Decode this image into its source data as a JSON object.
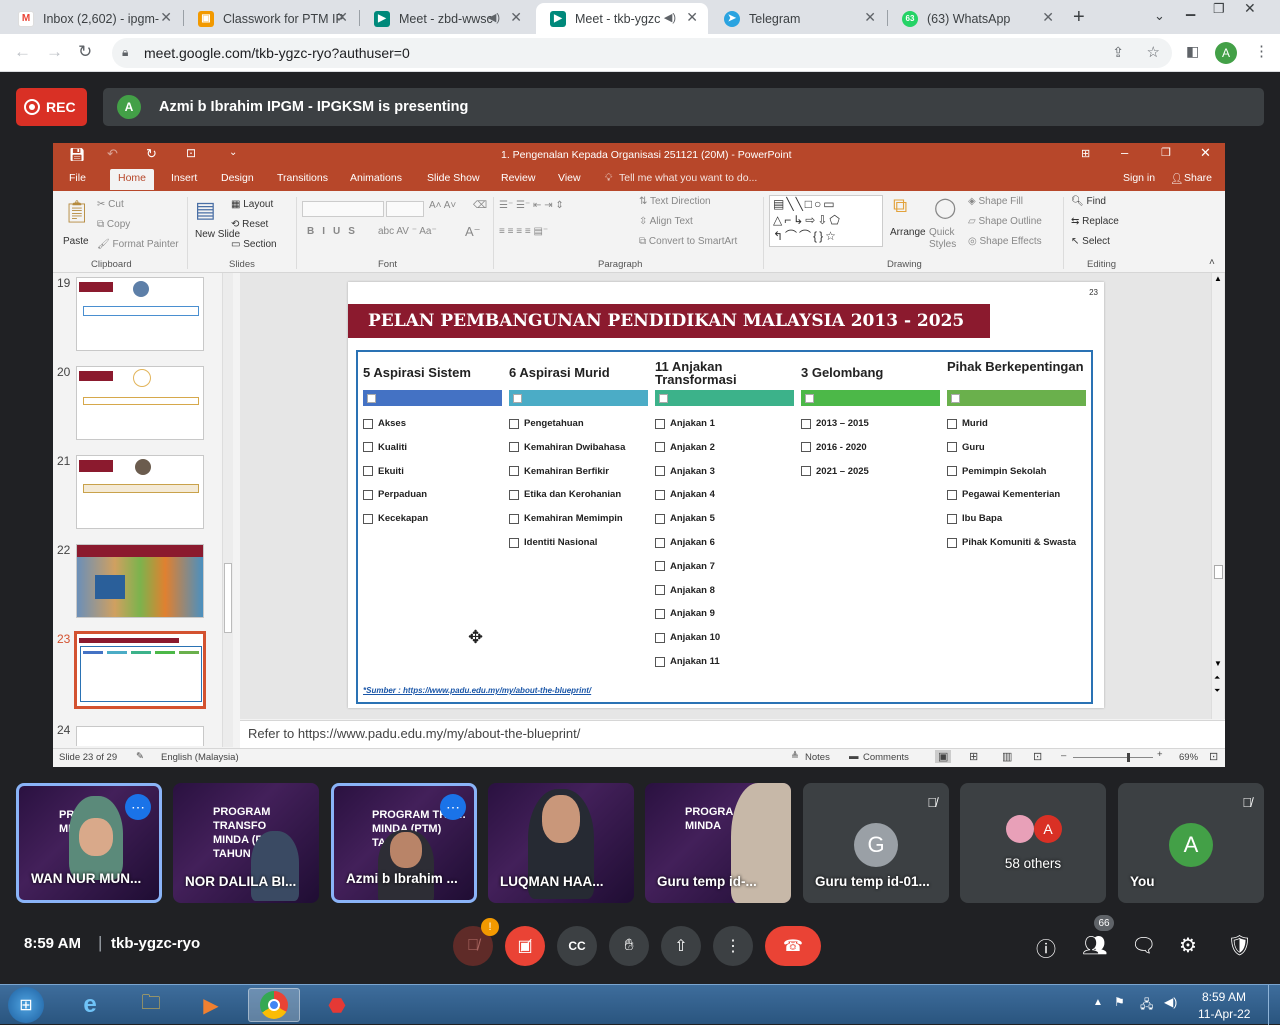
{
  "browser": {
    "tabs": [
      {
        "label": "Inbox (2,602) - ipgm-",
        "favicon": "gmail-icon"
      },
      {
        "label": "Classwork for PTM IP",
        "favicon": "classroom-icon"
      },
      {
        "label": "Meet - zbd-wwsc",
        "favicon": "meet-icon"
      },
      {
        "label": "Meet - tkb-ygzc",
        "favicon": "meet-icon"
      },
      {
        "label": "Telegram",
        "favicon": "telegram-icon"
      },
      {
        "label": "(63) WhatsApp",
        "favicon": "whatsapp-icon",
        "badge": "63"
      }
    ],
    "new_tab": "+",
    "url": "meet.google.com/tkb-ygzc-ryo?authuser=0",
    "profile_initial": "A"
  },
  "meet": {
    "rec_label": "REC",
    "presenter_initial": "A",
    "presenting_text": "Azmi b Ibrahim IPGM - IPGKSM is presenting",
    "time": "8:59 AM",
    "meeting_code": "tkb-ygzc-ryo",
    "people_count": "66",
    "mic_warning": "!",
    "tiles": [
      {
        "name": "WAN NUR MUN...",
        "video": true,
        "more": true
      },
      {
        "name": "NOR DALILA BI...",
        "video": true
      },
      {
        "name": "Azmi b Ibrahim ...",
        "video": true,
        "more": true
      },
      {
        "name": "LUQMAN HAA...",
        "video": true
      },
      {
        "name": "Guru temp id-...",
        "video": true
      },
      {
        "name": "Guru temp id-01...",
        "initial": "G",
        "muted": true
      },
      {
        "name": "58 others",
        "initials": [
          "A"
        ]
      },
      {
        "name": "You",
        "initial": "A",
        "muted": true
      }
    ],
    "video_text_1": "PROGRAM TRANSFORMASI MINDA (PTM) TAHUN"
  },
  "ppt": {
    "title": "1. Pengenalan Kepada Organisasi 251121 (20M) - PowerPoint",
    "sign_in": "Sign in",
    "share": "Share",
    "tabs": [
      "File",
      "Home",
      "Insert",
      "Design",
      "Transitions",
      "Animations",
      "Slide Show",
      "Review",
      "View"
    ],
    "tell_me": "Tell me what you want to do...",
    "ribbon": {
      "clipboard": {
        "paste": "Paste",
        "cut": "Cut",
        "copy": "Copy",
        "format_painter": "Format Painter",
        "group": "Clipboard"
      },
      "slides": {
        "new_slide": "New Slide",
        "layout": "Layout",
        "reset": "Reset",
        "section": "Section",
        "group": "Slides"
      },
      "font_group": "Font",
      "paragraph": {
        "text_direction": "Text Direction",
        "align_text": "Align Text",
        "convert": "Convert to SmartArt",
        "group": "Paragraph"
      },
      "drawing": {
        "arrange": "Arrange",
        "quick_styles": "Quick Styles",
        "shape_fill": "Shape Fill",
        "shape_outline": "Shape Outline",
        "shape_effects": "Shape Effects",
        "group": "Drawing"
      },
      "editing": {
        "find": "Find",
        "replace": "Replace",
        "select": "Select",
        "group": "Editing"
      }
    },
    "thumbnail_numbers": [
      "19",
      "20",
      "21",
      "22",
      "23",
      "24"
    ],
    "slide": {
      "number": "23",
      "title": "PELAN PEMBANGUNAN PENDIDIKAN MALAYSIA 2013 - 2025",
      "columns": [
        {
          "head": "5 Aspirasi Sistem",
          "color": "#4472c4",
          "items": [
            "Akses",
            "Kualiti",
            "Ekuiti",
            "Perpaduan",
            "Kecekapan"
          ]
        },
        {
          "head": "6 Aspirasi Murid",
          "color": "#4bacc6",
          "items": [
            "Pengetahuan",
            "Kemahiran Dwibahasa",
            "Kemahiran Berfikir",
            "Etika dan Kerohanian",
            "Kemahiran Memimpin",
            "Identiti Nasional"
          ]
        },
        {
          "head": "11 Anjakan Transformasi",
          "color": "#3cb28a",
          "items": [
            "Anjakan 1",
            "Anjakan 2",
            "Anjakan 3",
            "Anjakan 4",
            "Anjakan 5",
            "Anjakan 6",
            "Anjakan 7",
            "Anjakan 8",
            "Anjakan 9",
            "Anjakan 10",
            "Anjakan 11"
          ]
        },
        {
          "head": "3 Gelombang",
          "color": "#4cb848",
          "items": [
            "2013 – 2015",
            "2016 - 2020",
            "2021 – 2025"
          ]
        },
        {
          "head": "Pihak Berkepentingan",
          "color": "#6ab04c",
          "items": [
            "Murid",
            "Guru",
            "Pemimpin Sekolah",
            "Pegawai Kementerian",
            "Ibu Bapa",
            "Pihak Komuniti & Swasta"
          ]
        }
      ],
      "source": "*Sumber :  https://www.padu.edu.my/my/about-the-blueprint/"
    },
    "notes": "Refer to https://www.padu.edu.my/my/about-the-blueprint/",
    "status": {
      "slide": "Slide 23 of 29",
      "language": "English (Malaysia)",
      "notes": "Notes",
      "comments": "Comments",
      "zoom": "69%"
    }
  },
  "taskbar": {
    "time": "8:59 AM",
    "date": "11-Apr-22"
  }
}
